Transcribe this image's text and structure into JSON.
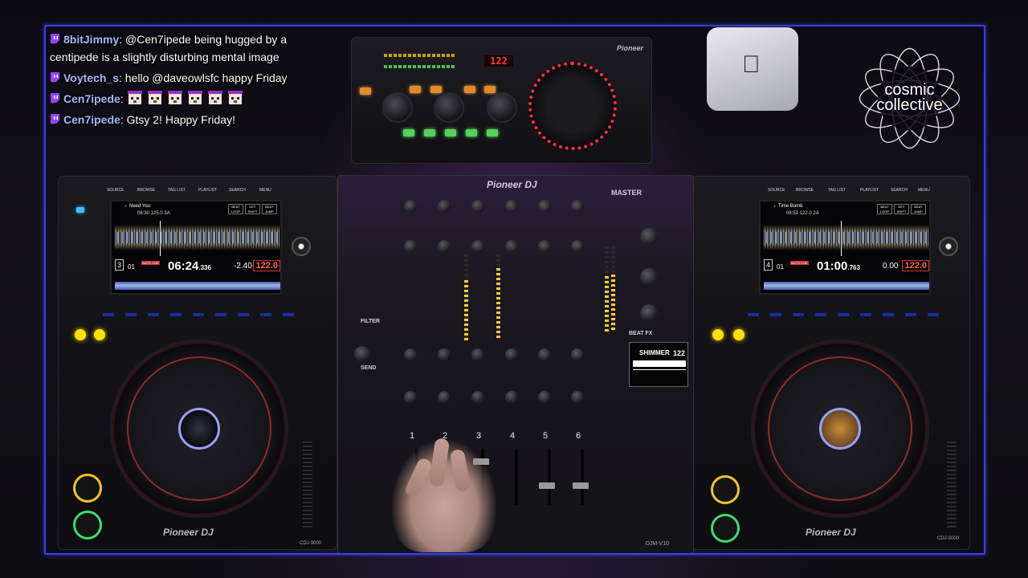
{
  "chat": {
    "messages": [
      {
        "user": "8bitJimmy",
        "separator": ":",
        "text": "@Cen7ipede being hugged by a centipede is a slightly disturbing mental image"
      },
      {
        "user": "Voytech_s",
        "separator": ":",
        "text": "hello @daveowlsfc happy Friday"
      },
      {
        "user": "Cen7ipede",
        "separator": ":",
        "emotes": [
          "pug-emote",
          "pug-emote",
          "pug-emote",
          "pug-emote",
          "pug-emote",
          "pug-emote"
        ],
        "text": ""
      },
      {
        "user": "Cen7ipede",
        "separator": ":",
        "text": "Gtsy 2! Happy Friday!"
      }
    ],
    "badge_icon": "twitch-badge-icon",
    "user_color": "#a8b8ff"
  },
  "logo": {
    "line1": "cosmic",
    "line2": "collective"
  },
  "rmx": {
    "brand": "Pioneer",
    "bpm_display": "122"
  },
  "mixer": {
    "brand": "Pioneer DJ",
    "master_label": "MASTER",
    "model": "DJM-V10",
    "channels": [
      "1",
      "2",
      "3",
      "4",
      "5",
      "6"
    ],
    "filter_label": "FILTER",
    "send_label": "SEND",
    "beat_fx": {
      "label": "BEAT FX",
      "effect": "SHIMMER",
      "bpm": "122"
    }
  },
  "cdj_left": {
    "tabs": [
      "SOURCE",
      "BROWSE",
      "TAG LIST",
      "PLAYLIST",
      "SEARCH",
      "MENU"
    ],
    "track_title": "Need You",
    "track_info": "06:30  125.0  3A",
    "deck_number": "3",
    "track_number": "01",
    "auto_cue_label": "AUTO CUE",
    "time_main": "06:24",
    "time_fraction": ".336",
    "tempo": "-2.40",
    "bpm": "122.0",
    "key": "3A",
    "screen_buttons": [
      "BEAT LOOP",
      "KEY SHIFT",
      "BEAT JUMP"
    ],
    "brand": "Pioneer DJ",
    "model": "CDJ-3000"
  },
  "cdj_right": {
    "tabs": [
      "SOURCE",
      "BROWSE",
      "TAG LIST",
      "PLAYLIST",
      "SEARCH",
      "MENU"
    ],
    "track_title": "Time Bomb",
    "track_info": "06:53  122.0  2A",
    "deck_number": "4",
    "track_number": "01",
    "auto_cue_label": "AUTO CUE",
    "time_main": "01:00",
    "time_fraction": ".763",
    "tempo": "0.00",
    "bpm": "122.0",
    "key": "2A",
    "screen_buttons": [
      "BEAT LOOP",
      "KEY SHIFT",
      "BEAT JUMP"
    ],
    "brand": "Pioneer DJ",
    "model": "CDJ-3000"
  },
  "frame_color": "#3c3cff"
}
